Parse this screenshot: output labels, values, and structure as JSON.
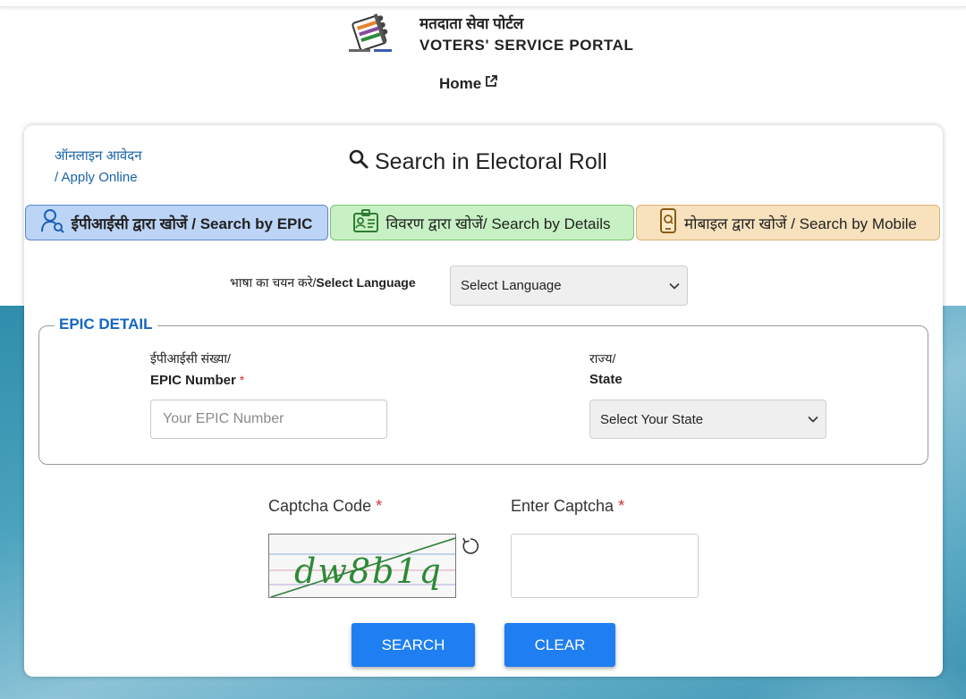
{
  "header": {
    "title_hindi": "मतदाता सेवा पोर्टल",
    "title_english": "VOTERS' SERVICE PORTAL",
    "home_label": "Home"
  },
  "card": {
    "apply_line1": "ऑनलाइन आवेदन",
    "apply_line2": "/ Apply Online",
    "title": "Search in Electoral Roll"
  },
  "tabs": [
    {
      "label": "ईपीआईसी द्वारा खोजें / Search by EPIC",
      "icon": "user-search-icon",
      "active": true
    },
    {
      "label": "विवरण द्वारा खोजें/ Search by Details",
      "icon": "id-card-icon",
      "active": false
    },
    {
      "label": "मोबाइल द्वारा खोजें / Search by Mobile",
      "icon": "mobile-search-icon",
      "active": false
    }
  ],
  "language": {
    "label_hindi": "भाषा का चयन करे/",
    "label_english": "Select Language",
    "selected": "Select Language"
  },
  "epic_detail": {
    "legend": "EPIC DETAIL",
    "epic_label_hindi": "ईपीआईसी संख्या/",
    "epic_label_english": "EPIC Number",
    "epic_placeholder": "Your EPIC Number",
    "state_label_hindi": "राज्य/",
    "state_label_english": "State",
    "state_selected": "Select Your State"
  },
  "captcha": {
    "code_label": "Captcha Code",
    "enter_label": "Enter Captcha",
    "image_text": "dw8b1q",
    "required_mark": "*"
  },
  "buttons": {
    "search": "SEARCH",
    "clear": "CLEAR"
  },
  "colors": {
    "primary_button": "#1e7ef2",
    "link": "#1a63a8",
    "legend": "#1565c0",
    "tab_epic": "#bcd4f6",
    "tab_details": "#c7f1c4",
    "tab_mobile": "#f7e2bd",
    "required": "#d32f2f"
  }
}
